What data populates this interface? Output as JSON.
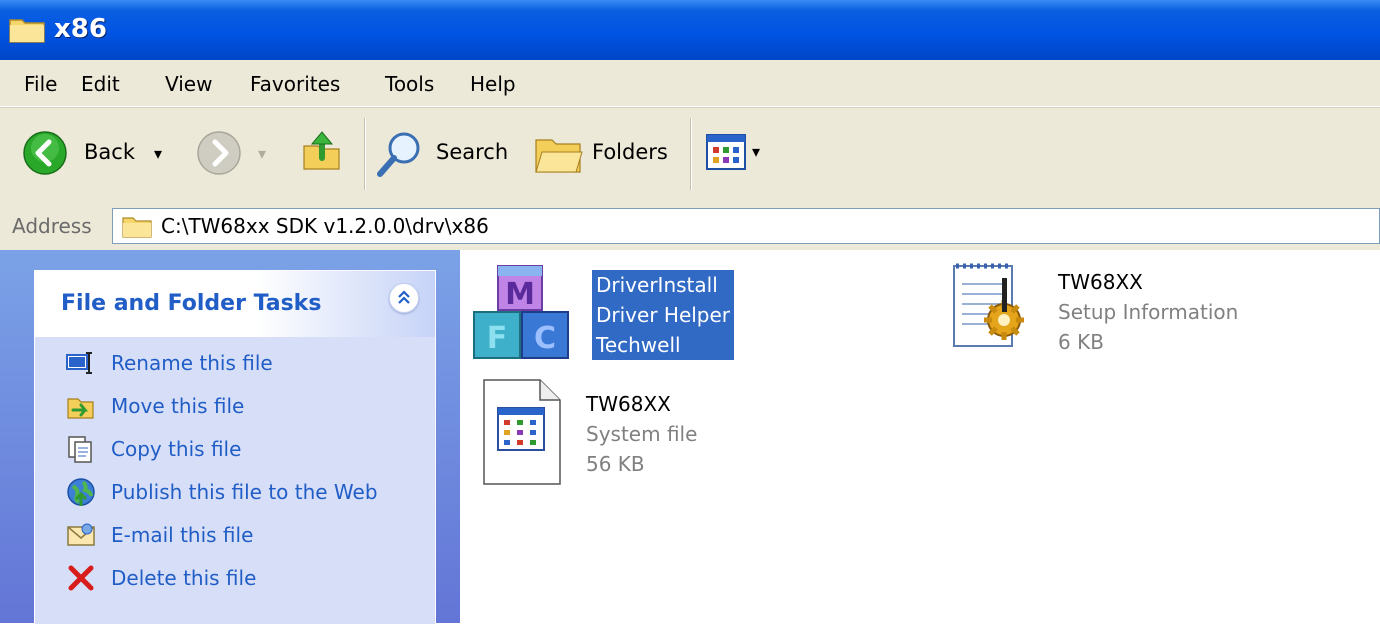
{
  "window": {
    "title": "x86"
  },
  "menu": {
    "items": [
      "File",
      "Edit",
      "View",
      "Favorites",
      "Tools",
      "Help"
    ]
  },
  "toolbar": {
    "back_label": "Back",
    "search_label": "Search",
    "folders_label": "Folders"
  },
  "address": {
    "label": "Address",
    "path": "C:\\TW68xx SDK v1.2.0.0\\drv\\x86"
  },
  "tasks": {
    "title": "File and Folder Tasks",
    "items": [
      {
        "label": "Rename this file",
        "icon": "rename-icon"
      },
      {
        "label": "Move this file",
        "icon": "move-icon"
      },
      {
        "label": "Copy this file",
        "icon": "copy-icon"
      },
      {
        "label": "Publish this file to the Web",
        "icon": "publish-web-icon"
      },
      {
        "label": "E-mail this file",
        "icon": "email-icon"
      },
      {
        "label": "Delete this file",
        "icon": "delete-icon"
      }
    ]
  },
  "files": [
    {
      "lines": [
        "DriverInstall",
        "Driver Helper",
        "Techwell"
      ],
      "icon": "application-icon",
      "selected": true
    },
    {
      "name": "TW68XX",
      "type": "Setup Information",
      "size": "6 KB",
      "icon": "setup-information-icon"
    },
    {
      "name": "TW68XX",
      "type": "System file",
      "size": "56 KB",
      "icon": "system-file-icon"
    }
  ],
  "colors": {
    "titlebar": "#0054e3",
    "selection": "#316ac5",
    "task_link": "#215dc6"
  }
}
